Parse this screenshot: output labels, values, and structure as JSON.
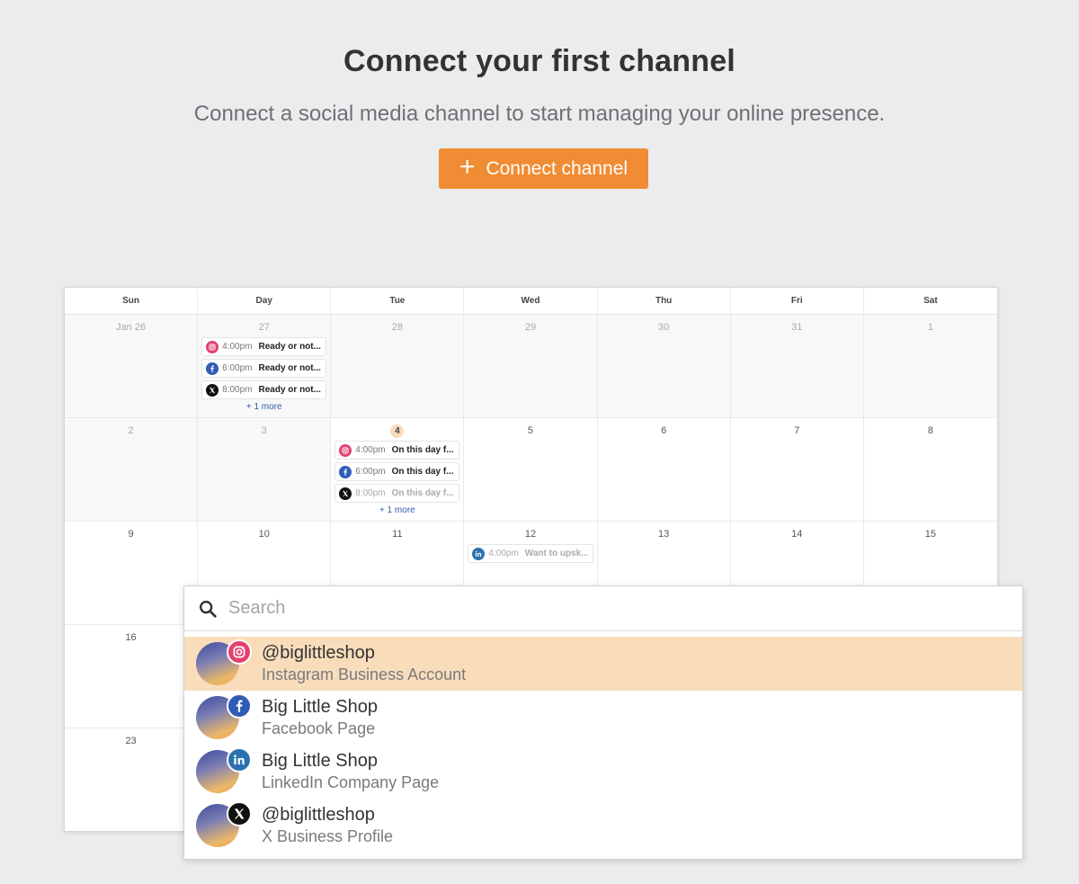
{
  "hero": {
    "title": "Connect your first channel",
    "subtitle": "Connect a social media channel to start managing your online presence.",
    "button_label": "Connect channel"
  },
  "calendar": {
    "weekdays": [
      "Sun",
      "Day",
      "Tue",
      "Wed",
      "Thu",
      "Fri",
      "Sat"
    ],
    "weeks": [
      [
        {
          "day": "Jan 26",
          "past": true
        },
        {
          "day": "27",
          "past": true,
          "posts": [
            {
              "network": "instagram",
              "time": "4:00pm",
              "title": "Ready or not..."
            },
            {
              "network": "facebook",
              "time": "6:00pm",
              "title": "Ready or not..."
            },
            {
              "network": "x",
              "time": "8:00pm",
              "title": "Ready or not..."
            }
          ],
          "more": "+ 1 more"
        },
        {
          "day": "28",
          "past": true
        },
        {
          "day": "29",
          "past": true
        },
        {
          "day": "30",
          "past": true
        },
        {
          "day": "31",
          "past": true
        },
        {
          "day": "1",
          "past": true
        }
      ],
      [
        {
          "day": "2",
          "past": true
        },
        {
          "day": "3",
          "past": true
        },
        {
          "day": "4",
          "today": true,
          "posts": [
            {
              "network": "instagram",
              "time": "4:00pm",
              "title": "On this day f..."
            },
            {
              "network": "facebook",
              "time": "6:00pm",
              "title": "On this day f..."
            },
            {
              "network": "x",
              "time": "8:00pm",
              "title": "On this day f...",
              "faded": true
            }
          ],
          "more": "+ 1 more"
        },
        {
          "day": "5"
        },
        {
          "day": "6"
        },
        {
          "day": "7"
        },
        {
          "day": "8"
        }
      ],
      [
        {
          "day": "9"
        },
        {
          "day": "10"
        },
        {
          "day": "11"
        },
        {
          "day": "12",
          "posts": [
            {
              "network": "linkedin",
              "time": "4:00pm",
              "title": "Want to upsk...",
              "faded": true
            }
          ]
        },
        {
          "day": "13"
        },
        {
          "day": "14"
        },
        {
          "day": "15"
        }
      ],
      [
        {
          "day": "16"
        },
        {
          "day": ""
        },
        {
          "day": ""
        },
        {
          "day": ""
        },
        {
          "day": ""
        },
        {
          "day": ""
        },
        {
          "day": ""
        }
      ],
      [
        {
          "day": "23"
        },
        {
          "day": ""
        },
        {
          "day": ""
        },
        {
          "day": ""
        },
        {
          "day": ""
        },
        {
          "day": ""
        },
        {
          "day": ""
        }
      ]
    ]
  },
  "dropdown": {
    "search_placeholder": "Search",
    "options": [
      {
        "name": "@biglittleshop",
        "type": "Instagram Business Account",
        "network": "instagram",
        "selected": true
      },
      {
        "name": "Big Little Shop",
        "type": "Facebook Page",
        "network": "facebook"
      },
      {
        "name": "Big Little Shop",
        "type": "LinkedIn Company Page",
        "network": "linkedin"
      },
      {
        "name": "@biglittleshop",
        "type": "X Business Profile",
        "network": "x"
      }
    ]
  },
  "colors": {
    "accent": "#f08c33",
    "selected_row": "#f9ddbb",
    "instagram": "#e4406f",
    "facebook": "#2f5cb6",
    "linkedin": "#2d72b0",
    "x": "#111111",
    "link": "#2e5ea9"
  }
}
